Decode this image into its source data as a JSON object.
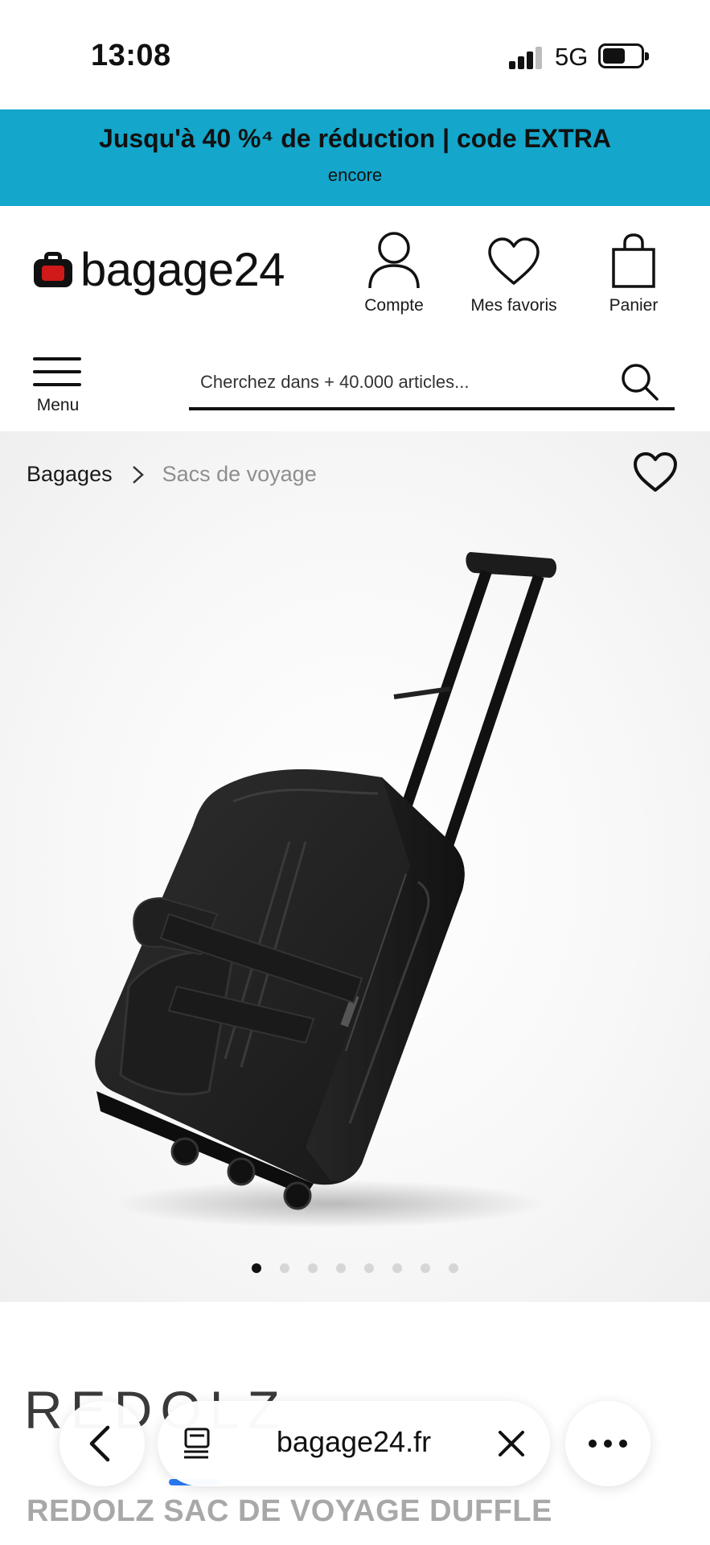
{
  "status_bar": {
    "time": "13:08",
    "network": "5G",
    "battery_level": 0.6
  },
  "promo": {
    "title": "Jusqu'à 40 %⁴ de réduction | code EXTRA",
    "subtitle": "encore",
    "bg_color": "#14a7cb"
  },
  "header": {
    "logo_text": "bagage24",
    "logo_accent": "#d01919",
    "account_label": "Compte",
    "favorites_label": "Mes favoris",
    "cart_label": "Panier",
    "menu_label": "Menu",
    "search_placeholder": "Cherchez dans + 40.000 articles..."
  },
  "product": {
    "breadcrumb": [
      "Bagages",
      "Sacs de voyage"
    ],
    "image_count": 8,
    "active_image_index": 0,
    "brand": "REDOLZ",
    "title": "REDOLZ SAC DE VOYAGE DUFFLE"
  },
  "browser_bar": {
    "domain": "bagage24.fr"
  }
}
